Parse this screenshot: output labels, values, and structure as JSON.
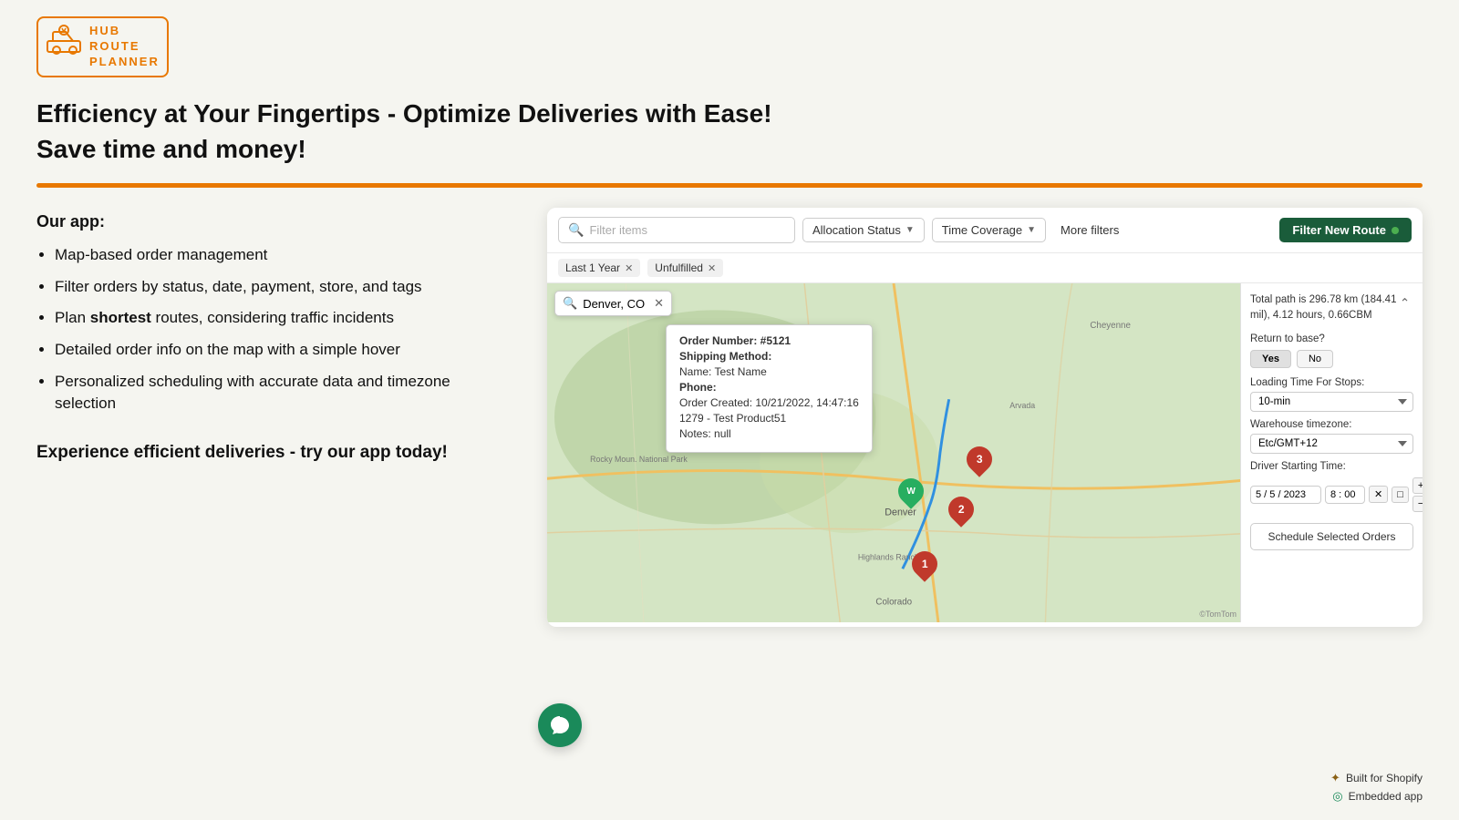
{
  "logo": {
    "text_line1": "HUB",
    "text_line2": "ROUTE",
    "text_line3": "PLANNER"
  },
  "hero": {
    "title_line1": "Efficiency at Your Fingertips - Optimize Deliveries with Ease!",
    "title_line2": "Save time and money!"
  },
  "left_panel": {
    "our_app_label": "Our app:",
    "features": [
      "Map-based order management",
      "Filter orders by status, date, payment, store, and tags",
      "Plan shortest routes, considering traffic incidents",
      "Detailed order info on the map with a simple hover",
      "Personalized scheduling with accurate data and timezone selection"
    ],
    "features_bold": [
      "",
      "",
      "shortest",
      "",
      ""
    ],
    "cta": "Experience efficient deliveries - try our app today!"
  },
  "toolbar": {
    "search_placeholder": "Filter items",
    "allocation_status_label": "Allocation Status",
    "time_coverage_label": "Time Coverage",
    "more_filters_label": "More filters",
    "filter_new_route_label": "Filter New Route"
  },
  "tags": [
    {
      "label": "Last 1 Year",
      "removable": true
    },
    {
      "label": "Unfulfilled",
      "removable": true
    }
  ],
  "map": {
    "search_value": "Denver, CO",
    "order_popup": {
      "order_number": "Order Number: #5121",
      "shipping_method": "Shipping Method:",
      "name": "Name: Test Name",
      "phone": "Phone:",
      "order_created": "Order Created: 10/21/2022, 14:47:16",
      "product": "1279 - Test Product51",
      "notes": "Notes: null"
    },
    "markers": [
      {
        "num": "1",
        "type": "red"
      },
      {
        "num": "2",
        "type": "red"
      },
      {
        "num": "3",
        "type": "red"
      },
      {
        "num": "W",
        "type": "green"
      }
    ],
    "tomtom_credit": "©TomTom"
  },
  "sidebar": {
    "path_info": "Total path is 296.78 km (184.41 mil), 4.12 hours, 0.66CBM",
    "return_base_label": "Return to base?",
    "yes_label": "Yes",
    "no_label": "No",
    "loading_time_label": "Loading Time For Stops:",
    "loading_time_value": "10-min",
    "warehouse_tz_label": "Warehouse timezone:",
    "warehouse_tz_value": "Etc/GMT+12",
    "driver_start_label": "Driver Starting Time:",
    "driver_date": "5 / 5 / 2023",
    "driver_time": "8 : 00",
    "schedule_btn_label": "Schedule Selected Orders"
  },
  "chat_bubble": {
    "icon": "chat-icon"
  },
  "footer_badges": {
    "shopify_label": "Built for Shopify",
    "embedded_label": "Embedded app"
  }
}
